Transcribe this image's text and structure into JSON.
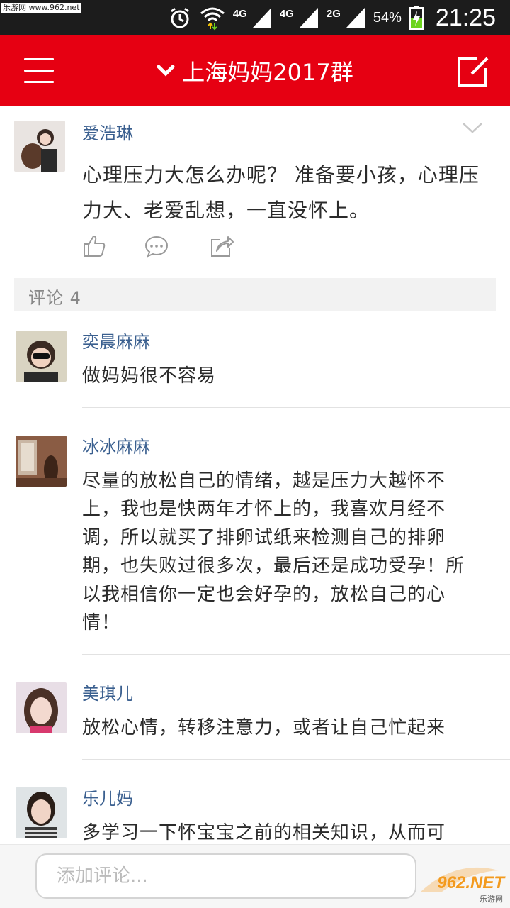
{
  "status_bar": {
    "watermark": "乐游网 www.962.net",
    "net1": "4G",
    "net2": "4G",
    "net3": "2G",
    "battery": "54%",
    "time": "21:25"
  },
  "app_bar": {
    "title": "上海妈妈2017群"
  },
  "post": {
    "author": "爱浩琳",
    "text": "心理压力大怎么办呢？ 准备要小孩，心理压力大、老爱乱想，一直没怀上。"
  },
  "comments_header": "评论 4",
  "comments": [
    {
      "author": "奕晨麻麻",
      "text": "做妈妈很不容易"
    },
    {
      "author": "冰冰麻麻",
      "text": "尽量的放松自己的情绪，越是压力大越怀不上，我也是快两年才怀上的，我喜欢月经不调，所以就买了排卵试纸来检测自己的排卵期，也失败过很多次，最后还是成功受孕！所以我相信你一定也会好孕的，放松自己的心情！"
    },
    {
      "author": "美琪儿",
      "text": "放松心情，转移注意力，或者让自己忙起来"
    },
    {
      "author": "乐儿妈",
      "text": "多学习一下怀宝宝之前的相关知识，从而可"
    }
  ],
  "bottom": {
    "input_placeholder": "添加评论...",
    "logo_text": "962.NET",
    "logo_sub": "乐游网"
  },
  "colors": {
    "app_bar": "#e60012",
    "author": "#3a5f8f",
    "status_bar": "#1c1c1c"
  },
  "icons": {
    "status": [
      "alarm-icon",
      "wifi-icon",
      "signal-icon",
      "battery-icon"
    ],
    "app_bar": [
      "menu-icon",
      "chevron-down-icon",
      "compose-icon"
    ],
    "post_actions": [
      "like-icon",
      "comment-icon",
      "share-icon"
    ]
  }
}
